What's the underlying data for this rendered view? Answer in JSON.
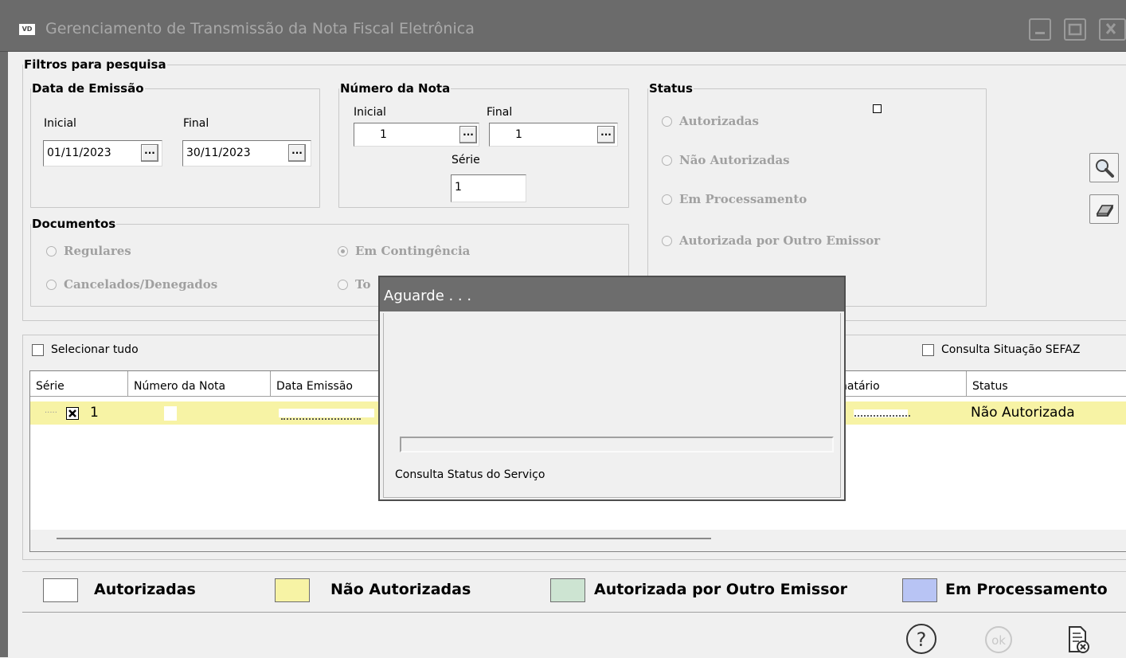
{
  "window": {
    "app_icon_text": "VD",
    "title": "Gerenciamento de Transmissão da Nota Fiscal Eletrônica"
  },
  "filters": {
    "legend": "Filtros para pesquisa",
    "data_emissao": {
      "legend": "Data de Emissão",
      "inicial_label": "Inicial",
      "final_label": "Final",
      "inicial_value": "01/11/2023",
      "final_value": "30/11/2023",
      "button_label": "..."
    },
    "numero_nota": {
      "legend": "Número da Nota",
      "inicial_label": "Inicial",
      "final_label": "Final",
      "inicial_value": "1",
      "final_value": "1",
      "serie_label": "Série",
      "serie_value": "1"
    },
    "documentos": {
      "legend": "Documentos",
      "options": [
        "Regulares",
        "Em Contingência",
        "Cancelados/Denegados",
        "To"
      ],
      "selected": "Em Contingência"
    },
    "status": {
      "legend": "Status",
      "options": [
        "Autorizadas",
        "Não Autorizadas",
        "Em Processamento",
        "Autorizada por Outro Emissor"
      ]
    }
  },
  "list": {
    "select_all_label": "Selecionar tudo",
    "sefaz_label": "Consulta Situação SEFAZ",
    "columns": [
      "Série",
      "Número da Nota",
      "Data Emissão",
      "natário",
      "Status"
    ],
    "rows": [
      {
        "serie": "1",
        "checked": true,
        "status": "Não Autorizada"
      }
    ]
  },
  "legend_bar": [
    {
      "label": "Autorizadas",
      "color": "#ffffff"
    },
    {
      "label": "Não Autorizadas",
      "color": "#f7f3a5"
    },
    {
      "label": "Autorizada por Outro Emissor",
      "color": "#cde4d2"
    },
    {
      "label": "Em Processamento",
      "color": "#b8c4f4"
    }
  ],
  "footer_icons": [
    "help-icon",
    "ok-icon",
    "close-document-icon"
  ],
  "footer": {
    "ok_label": "ok"
  },
  "modal": {
    "title": "Aguarde . . .",
    "message": "Consulta Status do Serviço",
    "progress": 0.0
  }
}
